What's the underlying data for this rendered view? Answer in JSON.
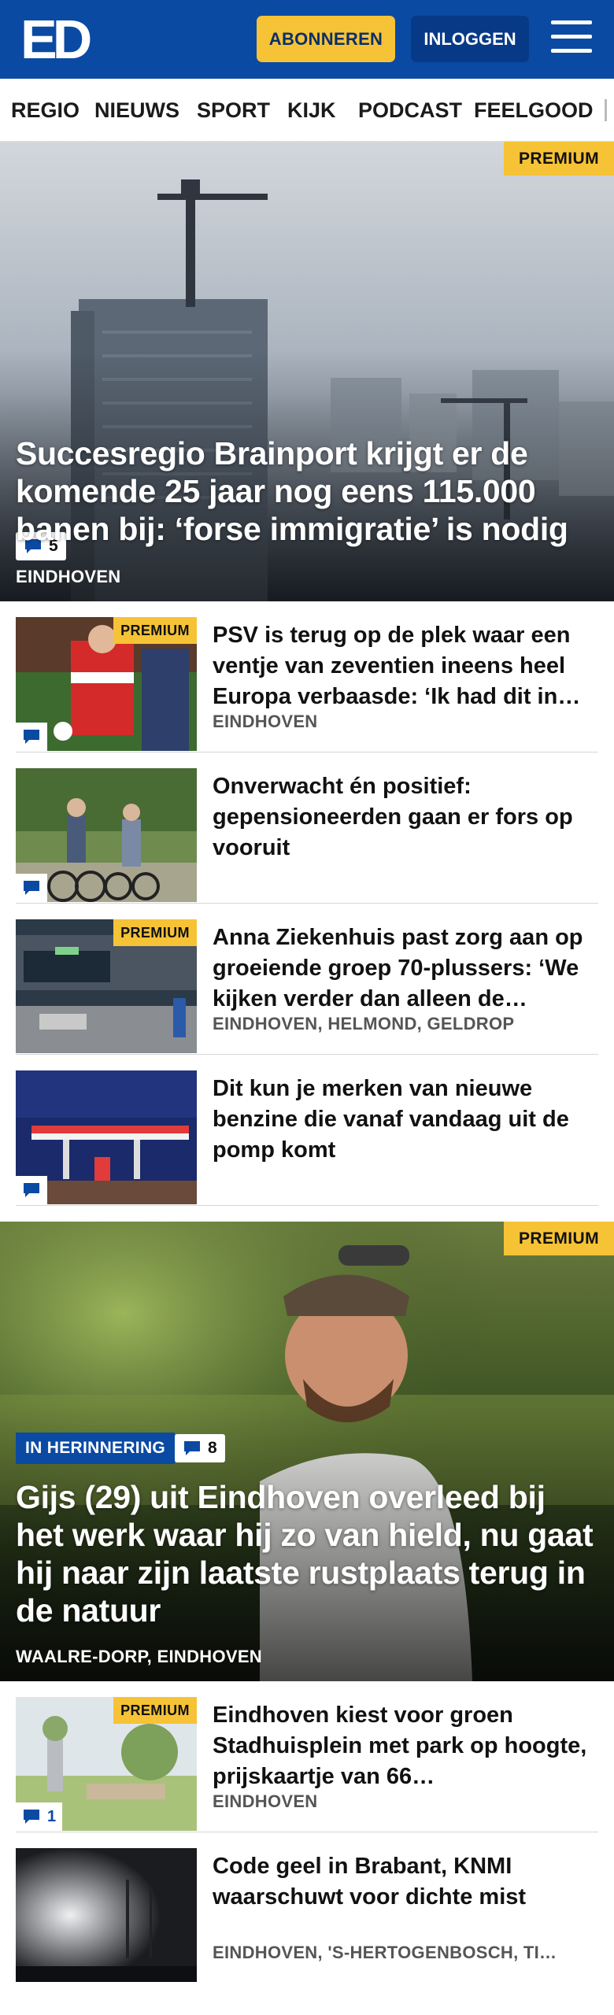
{
  "header": {
    "logo_text": "ED",
    "subscribe_label": "ABONNEREN",
    "login_label": "INLOGGEN",
    "bg_color": "#0a4aa3",
    "accent_color": "#f6c336"
  },
  "nav": {
    "items": [
      "REGIO",
      "NIEUWS",
      "SPORT",
      "KIJK",
      "PODCAST",
      "FEELGOOD"
    ]
  },
  "hero1": {
    "premium": "PREMIUM",
    "comments": "5",
    "title": "Succesregio Brainport krijgt er de komende 25 jaar nog eens 115.000 banen bij: ‘forse immigratie’ is nodig",
    "location": "EINDHOVEN"
  },
  "articles": [
    {
      "premium": "PREMIUM",
      "title": "PSV is terug op de plek waar een ventje van zeventien ineens heel Europa verbaasde: ‘Ik had dit in…",
      "location": "EINDHOVEN",
      "comments": ""
    },
    {
      "title": "Onverwacht én positief: gepensioneerden gaan er fors op vooruit",
      "location": "",
      "comments": ""
    },
    {
      "premium": "PREMIUM",
      "title": "Anna Ziekenhuis past zorg aan op groeiende groep 70-plussers: ‘We kijken verder dan alleen de…",
      "location": "EINDHOVEN, HELMOND, GELDROP",
      "comments": ""
    },
    {
      "title": "Dit kun je merken van nieuwe benzine die vanaf vandaag uit de pomp komt",
      "location": "",
      "comments": ""
    }
  ],
  "hero2": {
    "premium": "PREMIUM",
    "tag": "IN HERINNERING",
    "comments": "8",
    "title": "Gijs (29) uit Eindhoven overleed bij het werk waar hij zo van hield, nu gaat hij naar zijn laatste rustplaats terug in de natuur",
    "location": "WAALRE-DORP, EINDHOVEN"
  },
  "articles2": [
    {
      "premium": "PREMIUM",
      "title": "Eindhoven kiest voor groen Stadhuisplein met park op hoogte, prijskaartje van 66…",
      "location": "EINDHOVEN",
      "comments": "1"
    },
    {
      "title": "Code geel in Brabant, KNMI waarschuwt voor dichte mist",
      "location": "EINDHOVEN, 'S-HERTOGENBOSCH, TI…",
      "comments": ""
    }
  ]
}
